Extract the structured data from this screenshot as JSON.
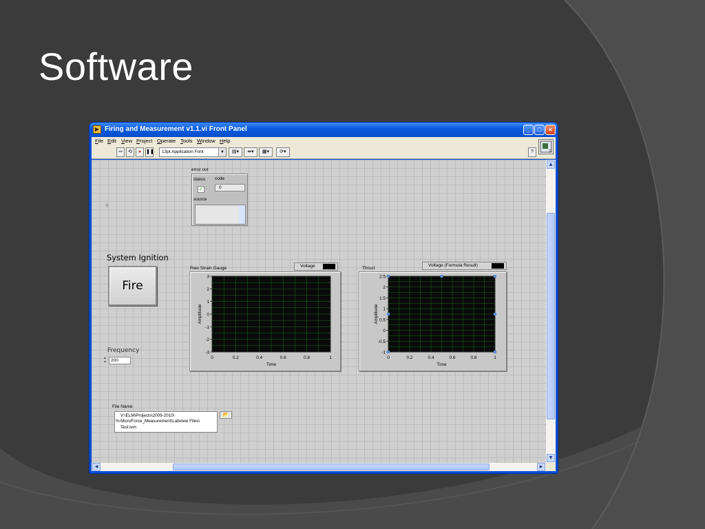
{
  "slide": {
    "title": "Software"
  },
  "window": {
    "title": "Firing and Measurement v1.1.vi Front Panel",
    "controls": {
      "minimize": "_",
      "maximize": "□",
      "close": "×"
    }
  },
  "menu": [
    "File",
    "Edit",
    "View",
    "Project",
    "Operate",
    "Tools",
    "Window",
    "Help"
  ],
  "toolbar": {
    "font": "13pt Application Font",
    "icons": [
      "run-arrow-icon",
      "run-continuous-icon",
      "abort-icon",
      "pause-icon",
      "align-icon",
      "distribute-icon",
      "resize-icon",
      "reorder-icon",
      "help-icon"
    ]
  },
  "error_out": {
    "label": "error out",
    "status_label": "status",
    "status_mark": "✓",
    "code_label": "code",
    "code_value": "0",
    "source_label": "source"
  },
  "ignition": {
    "label": "System Ignition",
    "button": "Fire"
  },
  "frequency": {
    "label": "Frequency",
    "value": "200"
  },
  "file": {
    "label": "File Name",
    "path_lines": [
      "V:\\ELM\\Projects\\2009-2010\\",
      "MicroForce_Measurement\\Labview Files\\",
      "Test.lvm"
    ],
    "prefix": "%"
  },
  "colors": {
    "plot_bg": "#0a0a0a",
    "plot_grid": "#1f6b1f",
    "marker": "#5a8ed8"
  },
  "chart_data": [
    {
      "type": "line",
      "title": "Raw Strain Gauge",
      "legend": "Voltage",
      "xlabel": "Time",
      "ylabel": "Amplitude",
      "xlim": [
        0,
        1
      ],
      "ylim": [
        -3,
        3
      ],
      "xticks": [
        "0",
        "0.2",
        "0.4",
        "0.6",
        "0.8",
        "1"
      ],
      "yticks": [
        "3",
        "2",
        "1",
        "0",
        "-1",
        "-2",
        "-3"
      ],
      "series": []
    },
    {
      "type": "line",
      "title": "Thrust",
      "legend": "Voltage (Formula Result)",
      "xlabel": "Time",
      "ylabel": "Amplitude",
      "xlim": [
        0,
        1
      ],
      "ylim": [
        -1,
        2.5
      ],
      "xticks": [
        "0",
        "0.2",
        "0.4",
        "0.6",
        "0.8",
        "1"
      ],
      "yticks": [
        "2.5",
        "2",
        "1.5",
        "1",
        "0.5",
        "0",
        "-0.5",
        "-1"
      ],
      "series": []
    }
  ]
}
